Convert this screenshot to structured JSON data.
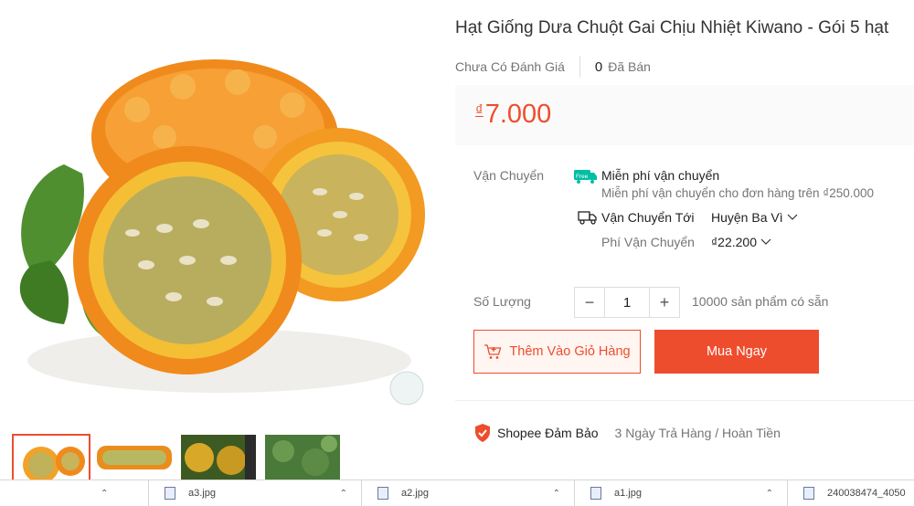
{
  "product": {
    "title": "Hạt Giống Dưa Chuột Gai Chịu Nhiệt Kiwano - Gói 5 hạt",
    "rating_text": "Chưa Có Đánh Giá",
    "sold_count": "0",
    "sold_label": "Đã Bán",
    "currency": "₫",
    "price": "7.000"
  },
  "shipping": {
    "label": "Vận Chuyển",
    "free_badge": "Free",
    "free_title": "Miễn phí vận chuyển",
    "free_sub": "Miễn phí vận chuyển cho đơn hàng trên ₫250.000",
    "ship_to_label": "Vận Chuyển Tới",
    "ship_to_value": "Huyện Ba Vì",
    "fee_label": "Phí Vận Chuyển",
    "fee_value": "₫22.200"
  },
  "quantity": {
    "label": "Số Lượng",
    "minus": "−",
    "value": "1",
    "plus": "+",
    "stock": "10000 sản phẩm có sẵn"
  },
  "actions": {
    "add_to_cart": "Thêm Vào Giỏ Hàng",
    "buy_now": "Mua Ngay"
  },
  "guarantee": {
    "title": "Shopee Đảm Bảo",
    "subtitle": "3 Ngày Trả Hàng / Hoàn Tiền"
  },
  "download_bar": {
    "items": [
      {
        "name": "a3.jpg"
      },
      {
        "name": "a2.jpg"
      },
      {
        "name": "a1.jpg"
      },
      {
        "name": "240038474_4050"
      }
    ]
  },
  "colors": {
    "accent": "#ee4d2d",
    "free_badge": "#00bfa5"
  }
}
